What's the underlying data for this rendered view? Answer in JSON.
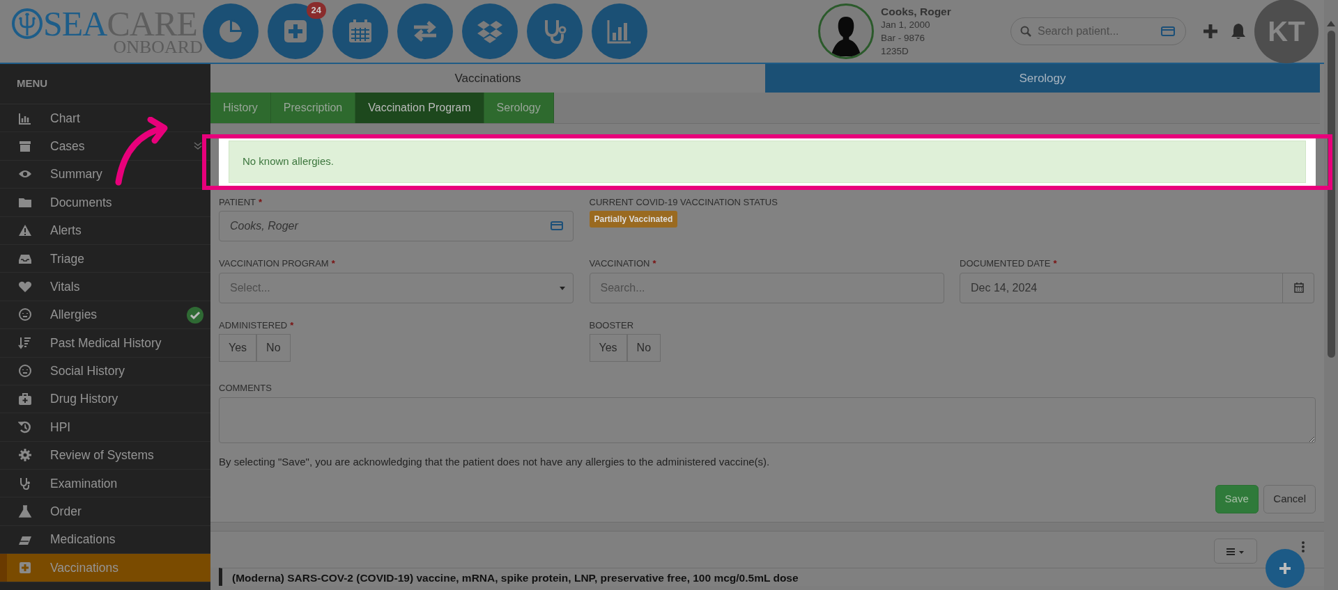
{
  "header": {
    "logo": {
      "part_1": "SEA",
      "part_2": "CARE",
      "part_3": "ONBOARD"
    },
    "notification_badge": "24",
    "patient": {
      "name": "Cooks, Roger",
      "dob": "Jan 1, 2000",
      "bar": "Bar - 9876",
      "id": "1235D"
    },
    "search": {
      "placeholder": "Search patient..."
    },
    "user": {
      "initials": "KT"
    }
  },
  "sidebar": {
    "title": "MENU",
    "items": [
      {
        "label": "Chart",
        "selected": false,
        "expandable": false,
        "completed": false
      },
      {
        "label": "Cases",
        "selected": false,
        "expandable": true,
        "completed": false
      },
      {
        "label": "Summary",
        "selected": false,
        "expandable": false,
        "completed": false
      },
      {
        "label": "Documents",
        "selected": false,
        "expandable": false,
        "completed": false
      },
      {
        "label": "Alerts",
        "selected": false,
        "expandable": false,
        "completed": false
      },
      {
        "label": "Triage",
        "selected": false,
        "expandable": false,
        "completed": false
      },
      {
        "label": "Vitals",
        "selected": false,
        "expandable": false,
        "completed": false
      },
      {
        "label": "Allergies",
        "selected": false,
        "expandable": false,
        "completed": true
      },
      {
        "label": "Past Medical History",
        "selected": false,
        "expandable": false,
        "completed": false
      },
      {
        "label": "Social History",
        "selected": false,
        "expandable": false,
        "completed": false
      },
      {
        "label": "Drug History",
        "selected": false,
        "expandable": false,
        "completed": false
      },
      {
        "label": "HPI",
        "selected": false,
        "expandable": false,
        "completed": false
      },
      {
        "label": "Review of Systems",
        "selected": false,
        "expandable": false,
        "completed": false
      },
      {
        "label": "Examination",
        "selected": false,
        "expandable": false,
        "completed": false
      },
      {
        "label": "Order",
        "selected": false,
        "expandable": false,
        "completed": false
      },
      {
        "label": "Medications",
        "selected": false,
        "expandable": false,
        "completed": false
      },
      {
        "label": "Vaccinations",
        "selected": true,
        "expandable": false,
        "completed": false
      }
    ]
  },
  "tabs": [
    {
      "label": "Vaccinations",
      "selected": true
    },
    {
      "label": "Serology",
      "selected": false
    }
  ],
  "subtabs": [
    {
      "label": "History",
      "selected": false
    },
    {
      "label": "Prescription",
      "selected": false
    },
    {
      "label": "Vaccination Program",
      "selected": true
    },
    {
      "label": "Serology",
      "selected": false
    }
  ],
  "alert": {
    "text": "No known allergies."
  },
  "form": {
    "patient": {
      "label": "PATIENT",
      "required_mark": "*",
      "value": "Cooks, Roger"
    },
    "status": {
      "label": "CURRENT COVID-19 VACCINATION STATUS",
      "badge": "Partially Vaccinated"
    },
    "program": {
      "label": "VACCINATION PROGRAM",
      "required_mark": "*",
      "placeholder": "Select..."
    },
    "vaccination": {
      "label": "VACCINATION",
      "required_mark": "*",
      "placeholder": "Search..."
    },
    "date": {
      "label": "DOCUMENTED DATE",
      "required_mark": "*",
      "value": "Dec 14, 2024"
    },
    "administered": {
      "label": "ADMINISTERED",
      "required_mark": "*",
      "options": [
        "Yes",
        "No"
      ]
    },
    "booster": {
      "label": "BOOSTER",
      "options": [
        "Yes",
        "No"
      ]
    },
    "comments": {
      "label": "COMMENTS"
    },
    "note": "By selecting \"Save\", you are acknowledging that the patient does not have any allergies to the administered vaccine(s).",
    "buttons": [
      {
        "label": "Save",
        "kind": "primary"
      },
      {
        "label": "Cancel",
        "kind": "secondary"
      }
    ]
  },
  "records": [
    {
      "title": "(Moderna) SARS-COV-2 (COVID-19) vaccine, mRNA, spike protein, LNP, preservative free, 100 mcg/0.5mL dose"
    }
  ]
}
